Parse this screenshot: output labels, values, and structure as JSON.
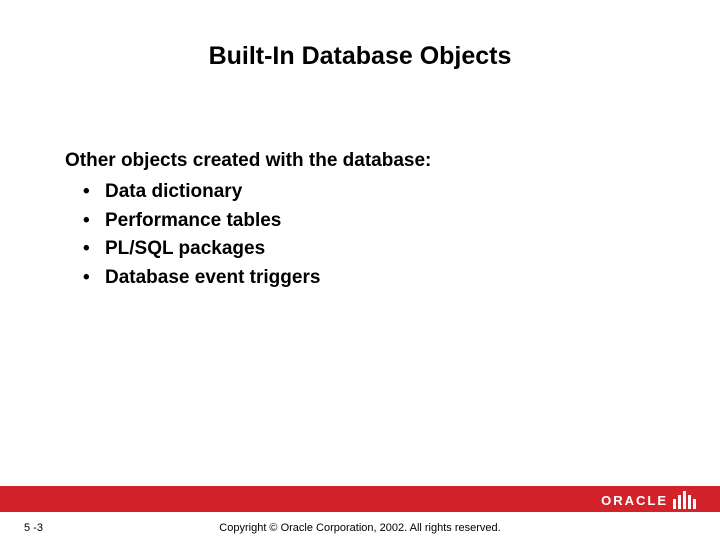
{
  "title": "Built-In Database Objects",
  "content": {
    "intro": "Other objects created with the database:",
    "bullets": [
      "Data dictionary",
      "Performance tables",
      "PL/SQL packages",
      "Database event triggers"
    ]
  },
  "footer": {
    "page_number": "5 -3",
    "copyright": "Copyright © Oracle Corporation, 2002. All rights reserved.",
    "logo_text": "ORACLE"
  },
  "colors": {
    "brand_red": "#d2232a"
  }
}
